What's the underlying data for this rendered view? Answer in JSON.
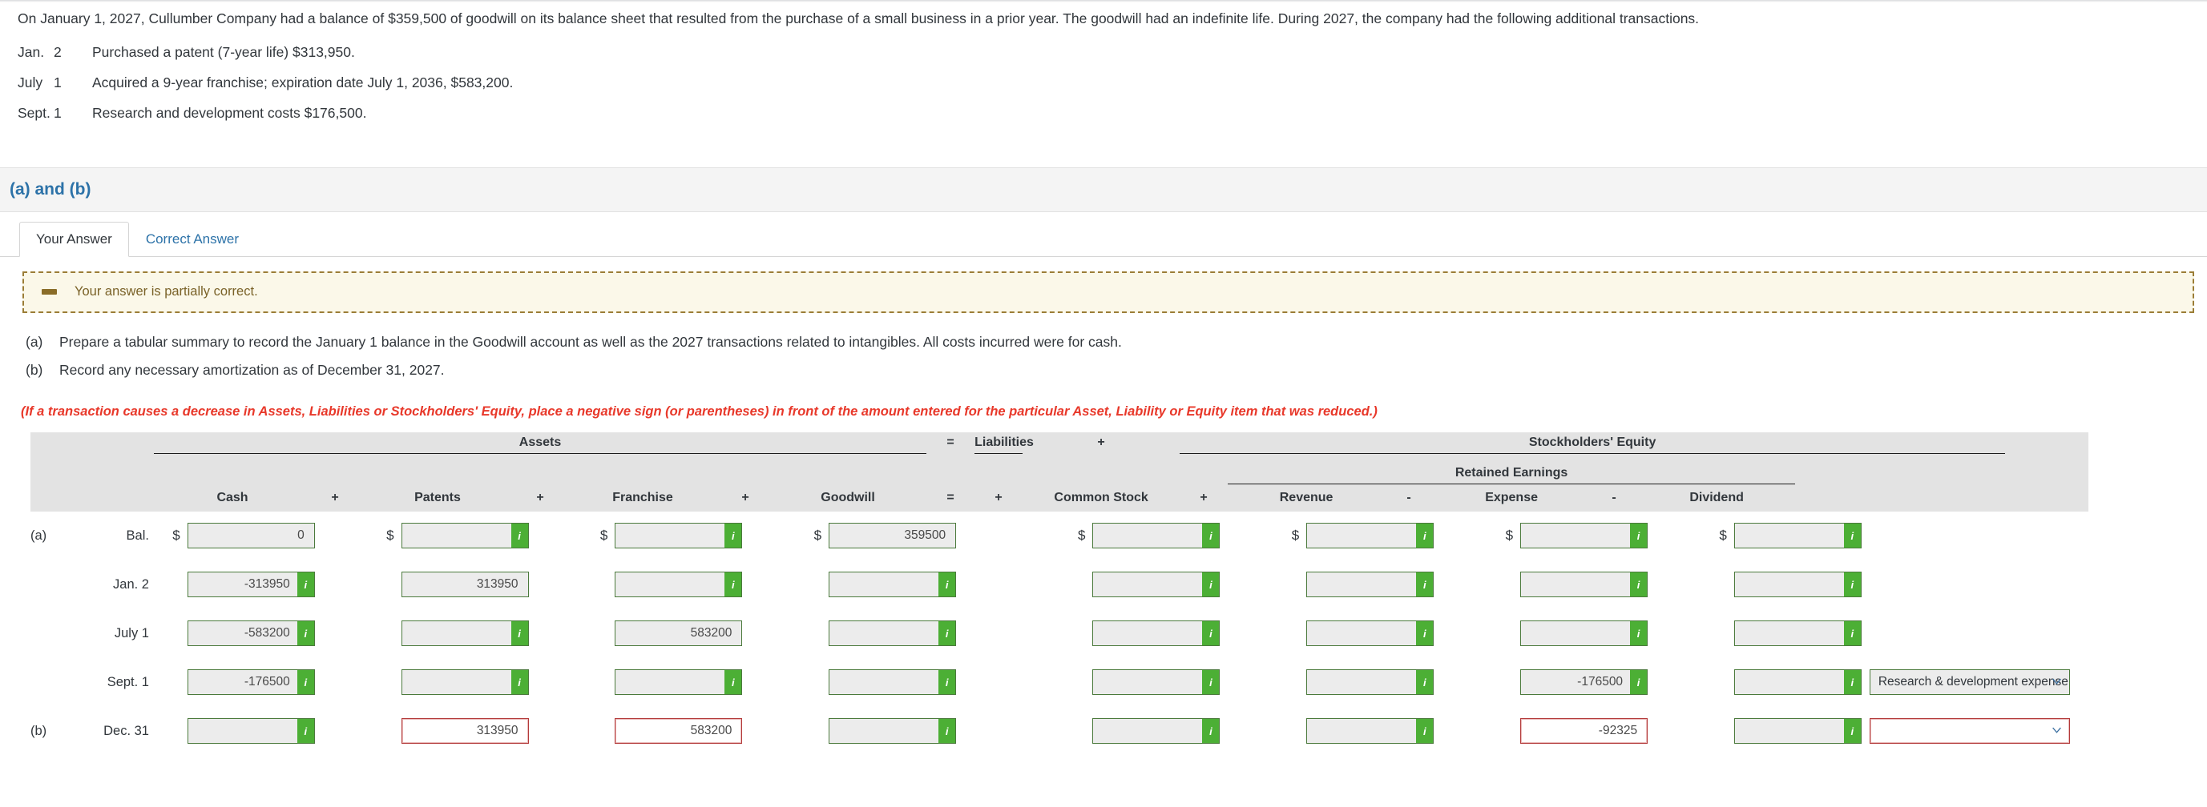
{
  "problem": {
    "statement": "On January 1, 2027, Cullumber Company had a balance of $359,500 of goodwill on its balance sheet that resulted from the purchase of a small business in a prior year. The goodwill had an indefinite life. During 2027, the company had the following additional transactions.",
    "transactions": [
      {
        "month": "Jan.",
        "day": "2",
        "description": "Purchased a patent (7-year life) $313,950."
      },
      {
        "month": "July",
        "day": "1",
        "description": "Acquired a 9-year franchise; expiration date July 1, 2036, $583,200."
      },
      {
        "month": "Sept.",
        "day": "1",
        "description": "Research and development costs $176,500."
      }
    ]
  },
  "section": {
    "title": "(a) and (b)"
  },
  "tabs": [
    {
      "label": "Your Answer",
      "active": true
    },
    {
      "label": "Correct Answer",
      "active": false
    }
  ],
  "alert": {
    "text": "Your answer is partially correct.",
    "icon": "minus-icon",
    "border_color": "#9b7d36",
    "background_color": "#fbf8e9",
    "text_color": "#7a6228"
  },
  "instructions": [
    {
      "letter": "(a)",
      "text": "Prepare a tabular summary to record the January 1 balance in the Goodwill account as well as the 2027 transactions related to intangibles. All costs incurred were for cash."
    },
    {
      "letter": "(b)",
      "text": "Record any necessary amortization as of December 31, 2027."
    }
  ],
  "note_negative": "(If a transaction causes a decrease in Assets, Liabilities or Stockholders' Equity, place a negative sign (or parentheses) in front of the amount entered for the particular Asset, Liability or Equity item that was reduced.)",
  "worksheet": {
    "group_headers": {
      "assets": "Assets",
      "eq_sign": "=",
      "liabilities": "Liabilities",
      "plus_sign": "+",
      "stockholders_equity": "Stockholders' Equity",
      "retained_earnings": "Retained Earnings"
    },
    "column_headers": {
      "cash": "Cash",
      "op1": "+",
      "patents": "Patents",
      "op2": "+",
      "franchise": "Franchise",
      "op3": "+",
      "goodwill": "Goodwill",
      "op4": "=",
      "op5": "+",
      "common_stock": "Common Stock",
      "op6": "+",
      "revenue": "Revenue",
      "op7": "-",
      "expense": "Expense",
      "op8": "-",
      "dividend": "Dividend"
    },
    "rows": [
      {
        "tag": "(a)",
        "date": "Bal.",
        "show_dollar": true,
        "cash": {
          "value": "0",
          "badge": false,
          "error": false
        },
        "patents": {
          "value": "",
          "badge": true,
          "error": false
        },
        "franchise": {
          "value": "",
          "badge": true,
          "error": false
        },
        "goodwill": {
          "value": "359500",
          "badge": false,
          "error": false
        },
        "common_stock": {
          "value": "",
          "badge": true,
          "error": false
        },
        "revenue": {
          "value": "",
          "badge": true,
          "error": false
        },
        "expense": {
          "value": "",
          "badge": true,
          "error": false
        },
        "dividend": {
          "value": "",
          "badge": true,
          "error": false
        },
        "dropdown": null
      },
      {
        "tag": "",
        "date": "Jan. 2",
        "show_dollar": false,
        "cash": {
          "value": "-313950",
          "badge": true,
          "error": false
        },
        "patents": {
          "value": "313950",
          "badge": false,
          "error": false
        },
        "franchise": {
          "value": "",
          "badge": true,
          "error": false
        },
        "goodwill": {
          "value": "",
          "badge": true,
          "error": false
        },
        "common_stock": {
          "value": "",
          "badge": true,
          "error": false
        },
        "revenue": {
          "value": "",
          "badge": true,
          "error": false
        },
        "expense": {
          "value": "",
          "badge": true,
          "error": false
        },
        "dividend": {
          "value": "",
          "badge": true,
          "error": false
        },
        "dropdown": null
      },
      {
        "tag": "",
        "date": "July 1",
        "show_dollar": false,
        "cash": {
          "value": "-583200",
          "badge": true,
          "error": false
        },
        "patents": {
          "value": "",
          "badge": true,
          "error": false
        },
        "franchise": {
          "value": "583200",
          "badge": false,
          "error": false
        },
        "goodwill": {
          "value": "",
          "badge": true,
          "error": false
        },
        "common_stock": {
          "value": "",
          "badge": true,
          "error": false
        },
        "revenue": {
          "value": "",
          "badge": true,
          "error": false
        },
        "expense": {
          "value": "",
          "badge": true,
          "error": false
        },
        "dividend": {
          "value": "",
          "badge": true,
          "error": false
        },
        "dropdown": null
      },
      {
        "tag": "",
        "date": "Sept. 1",
        "show_dollar": false,
        "cash": {
          "value": "-176500",
          "badge": true,
          "error": false
        },
        "patents": {
          "value": "",
          "badge": true,
          "error": false
        },
        "franchise": {
          "value": "",
          "badge": true,
          "error": false
        },
        "goodwill": {
          "value": "",
          "badge": true,
          "error": false
        },
        "common_stock": {
          "value": "",
          "badge": true,
          "error": false
        },
        "revenue": {
          "value": "",
          "badge": true,
          "error": false
        },
        "expense": {
          "value": "-176500",
          "badge": true,
          "error": false
        },
        "dividend": {
          "value": "",
          "badge": true,
          "error": false
        },
        "dropdown": {
          "value": "Research & development expense",
          "error": false
        }
      },
      {
        "tag": "(b)",
        "date": "Dec. 31",
        "show_dollar": false,
        "cash": {
          "value": "",
          "badge": true,
          "error": false
        },
        "patents": {
          "value": "313950",
          "badge": false,
          "error": true
        },
        "franchise": {
          "value": "583200",
          "badge": false,
          "error": true
        },
        "goodwill": {
          "value": "",
          "badge": true,
          "error": false
        },
        "common_stock": {
          "value": "",
          "badge": true,
          "error": false
        },
        "revenue": {
          "value": "",
          "badge": true,
          "error": false
        },
        "expense": {
          "value": "-92325",
          "badge": false,
          "error": true
        },
        "dividend": {
          "value": "",
          "badge": true,
          "error": false
        },
        "dropdown": {
          "value": "",
          "error": true
        }
      }
    ],
    "badge_label": "i",
    "currency_symbol": "$",
    "colors": {
      "field_border": "#4b7a3c",
      "badge_green": "#4caf35",
      "error_red": "#b33a3a",
      "header_background": "#e3e3e3"
    }
  }
}
